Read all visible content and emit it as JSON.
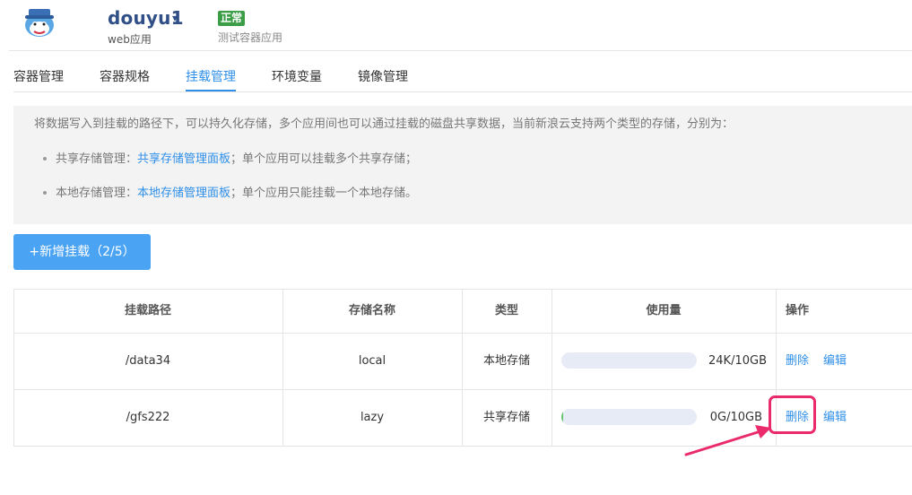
{
  "header": {
    "app_name": "douyu1",
    "caret": "▾",
    "app_type": "web应用",
    "status": "正常",
    "description": "测试容器应用"
  },
  "tabs": [
    {
      "label": "容器管理",
      "active": false
    },
    {
      "label": "容器规格",
      "active": false
    },
    {
      "label": "挂载管理",
      "active": true
    },
    {
      "label": "环境变量",
      "active": false
    },
    {
      "label": "镜像管理",
      "active": false
    }
  ],
  "info": {
    "intro": "将数据写入到挂载的路径下，可以持久化存储，多个应用间也可以通过挂载的磁盘共享数据，当前新浪云支持两个类型的存储，分别为：",
    "items": [
      {
        "prefix": "共享存储管理：",
        "link": "共享存储管理面板",
        "suffix": "；单个应用可以挂载多个共享存储；"
      },
      {
        "prefix": "本地存储管理：",
        "link": "本地存储管理面板",
        "suffix": "；单个应用只能挂载一个本地存储。"
      }
    ]
  },
  "add_button": "+新增挂载（2/5）",
  "table": {
    "headers": [
      "挂载路径",
      "存储名称",
      "类型",
      "使用量",
      "操作"
    ],
    "rows": [
      {
        "path": "/data34",
        "name": "local",
        "type": "本地存储",
        "usage": "24K/10GB",
        "usage_fraction": 0.0,
        "actions": [
          "删除",
          "编辑"
        ]
      },
      {
        "path": "/gfs222",
        "name": "lazy",
        "type": "共享存储",
        "usage": "0G/10GB",
        "usage_fraction": 0.01,
        "actions": [
          "删除",
          "编辑"
        ]
      }
    ]
  },
  "colors": {
    "accent": "#2f8fe8",
    "primary_button": "#4ba3f4",
    "status_ok": "#3c9d47",
    "highlight": "#ea2a6a"
  }
}
